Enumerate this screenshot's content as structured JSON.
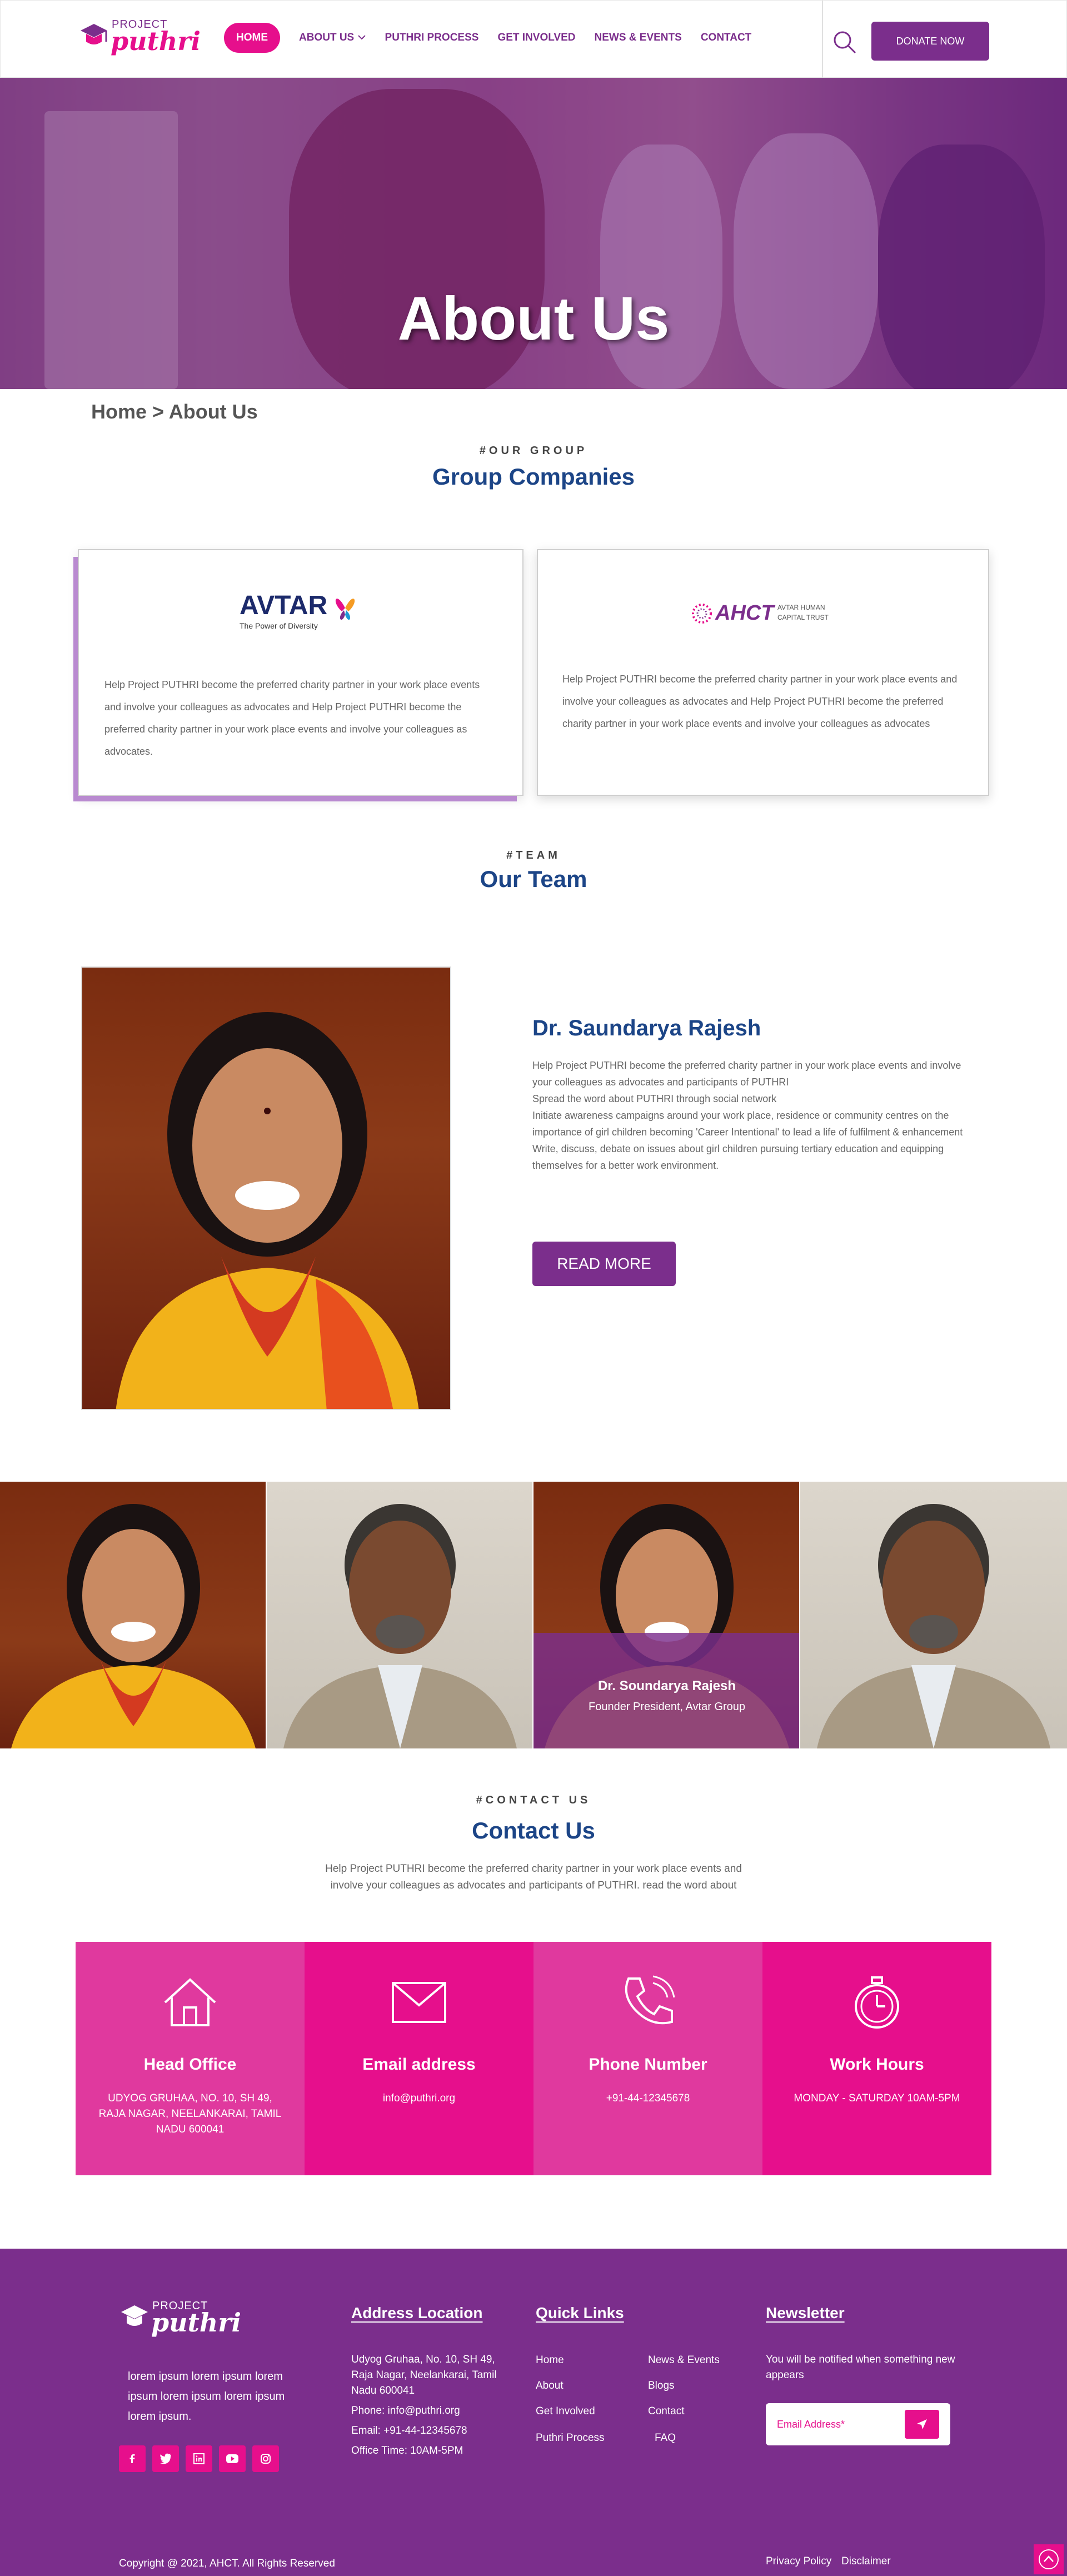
{
  "nav": {
    "logo_small": "PROJECT",
    "logo_big": "puthri",
    "links": [
      "HOME",
      "ABOUT US",
      "PUTHRI PROCESS",
      "GET INVOLVED",
      "NEWS & EVENTS",
      "CONTACT"
    ],
    "donate": "DONATE NOW"
  },
  "hero": {
    "title": "About Us"
  },
  "breadcrumb": "Home > About Us",
  "group": {
    "eyebrow": "#OUR GROUP",
    "title": "Group Companies",
    "companies": [
      {
        "logo_text": "AVTAR",
        "tagline": "The Power of Diversity",
        "desc": "Help Project PUTHRI become the preferred charity partner in your work place events and involve your colleagues as advocates and Help Project PUTHRI become the preferred charity partner in your work place events and involve your colleagues as advocates."
      },
      {
        "logo_text": "AHCT",
        "tagline": "AVTAR HUMAN CAPITAL TRUST",
        "desc": "Help Project PUTHRI become the preferred charity partner in your work place events and involve your colleagues as advocates and Help Project PUTHRI become the preferred charity partner in your work place events and involve your colleagues as advocates"
      }
    ]
  },
  "team": {
    "eyebrow": "#TEAM",
    "title": "Our Team",
    "member_name": "Dr. Saundarya Rajesh",
    "bio": [
      "Help Project PUTHRI become the preferred charity partner in your work place events and involve your colleagues as advocates and participants of PUTHRI",
      "Spread the word about PUTHRI through social network",
      "Initiate awareness campaigns around your work place, residence or community centres on the importance of girl children becoming 'Career Intentional' to lead a life of fulfilment & enhancement",
      "Write, discuss, debate on issues about girl children pursuing tertiary education and equipping themselves for a better work environment."
    ],
    "read_more": "READ MORE",
    "caption_name": "Dr. Soundarya Rajesh",
    "caption_role": "Founder President, Avtar Group"
  },
  "contact": {
    "eyebrow": "#CONTACT US",
    "title": "Contact Us",
    "intro": "Help Project PUTHRI become the preferred charity partner in your work place events and involve your colleagues as advocates and participants of PUTHRI. read the word about",
    "boxes": [
      {
        "head": "Head Office",
        "body": "UDYOG GRUHAA, NO. 10, SH 49, RAJA NAGAR, NEELANKARAI, TAMIL NADU 600041",
        "color": "#e0399e"
      },
      {
        "head": "Email address",
        "body": "info@puthri.org",
        "color": "#e60f8c"
      },
      {
        "head": "Phone Number",
        "body": "+91-44-12345678",
        "color": "#e0399e"
      },
      {
        "head": "Work Hours",
        "body": "MONDAY - SATURDAY 10AM-5PM",
        "color": "#e60f8c"
      }
    ]
  },
  "footer": {
    "about": "lorem ipsum lorem ipsum lorem ipsum lorem ipsum lorem ipsum lorem ipsum.",
    "address_title": "Address Location",
    "address": "Udyog Gruhaa, No. 10, SH 49, Raja Nagar, Neelankarai, Tamil Nadu 600041",
    "phone": "Phone: info@puthri.org",
    "email": "Email: +91-44-12345678",
    "office_time": "Office Time: 10AM-5PM",
    "quick_title": "Quick Links",
    "links_col1": [
      "Home",
      "About",
      "Get Involved",
      "Puthri Process"
    ],
    "links_col2": [
      "News & Events",
      "Blogs",
      "Contact",
      "FAQ"
    ],
    "news_title": "Newsletter",
    "news_text": "You will be notified when something new appears",
    "email_placeholder": "Email Address*",
    "copyright": "Copyright @ 2021, AHCT. All Rights Reserved",
    "privacy": "Privacy Policy",
    "disclaimer": "Disclaimer"
  },
  "colors": {
    "brand_purple": "#7b2e8c",
    "brand_pink": "#e60f8c",
    "heading_blue": "#1c4587"
  }
}
